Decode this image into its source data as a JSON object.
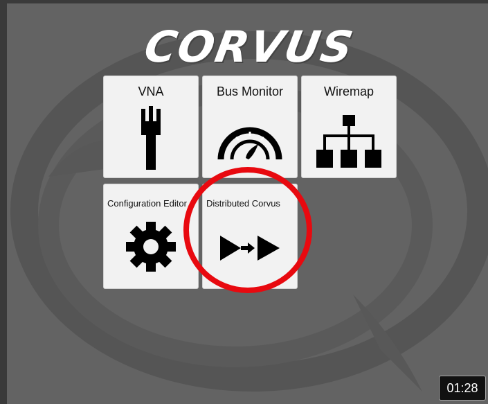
{
  "app": {
    "logo_text": "CORVUS"
  },
  "tiles": [
    {
      "label": "VNA",
      "icon": "vna-probe-icon"
    },
    {
      "label": "Bus Monitor",
      "icon": "gauge-icon"
    },
    {
      "label": "Wiremap",
      "icon": "network-tree-icon"
    },
    {
      "label": "Configuration Editor",
      "icon": "gear-icon"
    },
    {
      "label": "Distributed Corvus",
      "icon": "double-play-arrow-icon"
    }
  ],
  "annotation": {
    "color": "#e8090f"
  },
  "video": {
    "timestamp": "01:28"
  }
}
